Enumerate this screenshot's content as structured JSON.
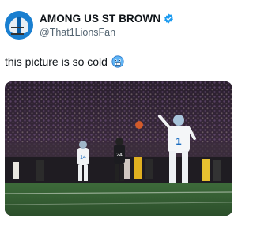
{
  "post": {
    "display_name": "AMONG US ST BROWN",
    "handle": "@That1LionsFan",
    "text": "this picture is so cold",
    "emoji": "cold-face-emoji"
  },
  "media": {
    "description_icon": "photo",
    "player_numbers": [
      "14",
      "24",
      "1"
    ]
  },
  "colors": {
    "verified": "#1d9bf0",
    "text": "#0f1419",
    "handle": "#536471"
  }
}
